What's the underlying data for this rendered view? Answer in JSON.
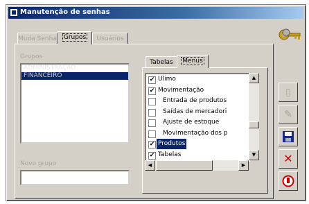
{
  "window": {
    "title": "Manutenção de senhas"
  },
  "tabs": [
    {
      "label": "Muda Senha",
      "disabled": true
    },
    {
      "label": "Grupos",
      "active": true
    },
    {
      "label": "Usuários",
      "disabled": true
    }
  ],
  "groups_panel": {
    "groups_label": "Grupos",
    "groups": [
      {
        "name": "ADMINISTRAÇÃO",
        "selected": false
      },
      {
        "name": "FINANCEIRO",
        "selected": true
      }
    ],
    "new_group_label": "Novo grupo",
    "new_group_value": ""
  },
  "inner_tabs": [
    {
      "label": "Tabelas",
      "active": false
    },
    {
      "label": "Menus",
      "active": true
    }
  ],
  "menu_items": [
    {
      "label": "Ulimo",
      "checked": true,
      "indent": false,
      "selected": false
    },
    {
      "label": "Movimentação",
      "checked": true,
      "indent": false,
      "selected": false
    },
    {
      "label": "Entrada de produtos",
      "checked": false,
      "indent": true,
      "selected": false
    },
    {
      "label": "Saídas de mercadori",
      "checked": false,
      "indent": true,
      "selected": false
    },
    {
      "label": "Ajuste de estoque",
      "checked": false,
      "indent": true,
      "selected": false
    },
    {
      "label": "Movimentação dos p",
      "checked": false,
      "indent": true,
      "selected": false
    },
    {
      "label": "Produtos",
      "checked": true,
      "indent": false,
      "selected": true
    },
    {
      "label": "Tabelas",
      "checked": true,
      "indent": false,
      "selected": false
    }
  ],
  "icons": {
    "keys": "keys-icon",
    "new": "new-icon",
    "edit": "edit-icon",
    "save": "save-icon",
    "delete": "delete-icon",
    "exit": "exit-icon"
  },
  "colors": {
    "title_start": "#0a246a",
    "selection": "#0a246a",
    "delete": "#cc0000",
    "face": "#d4d0c8"
  }
}
